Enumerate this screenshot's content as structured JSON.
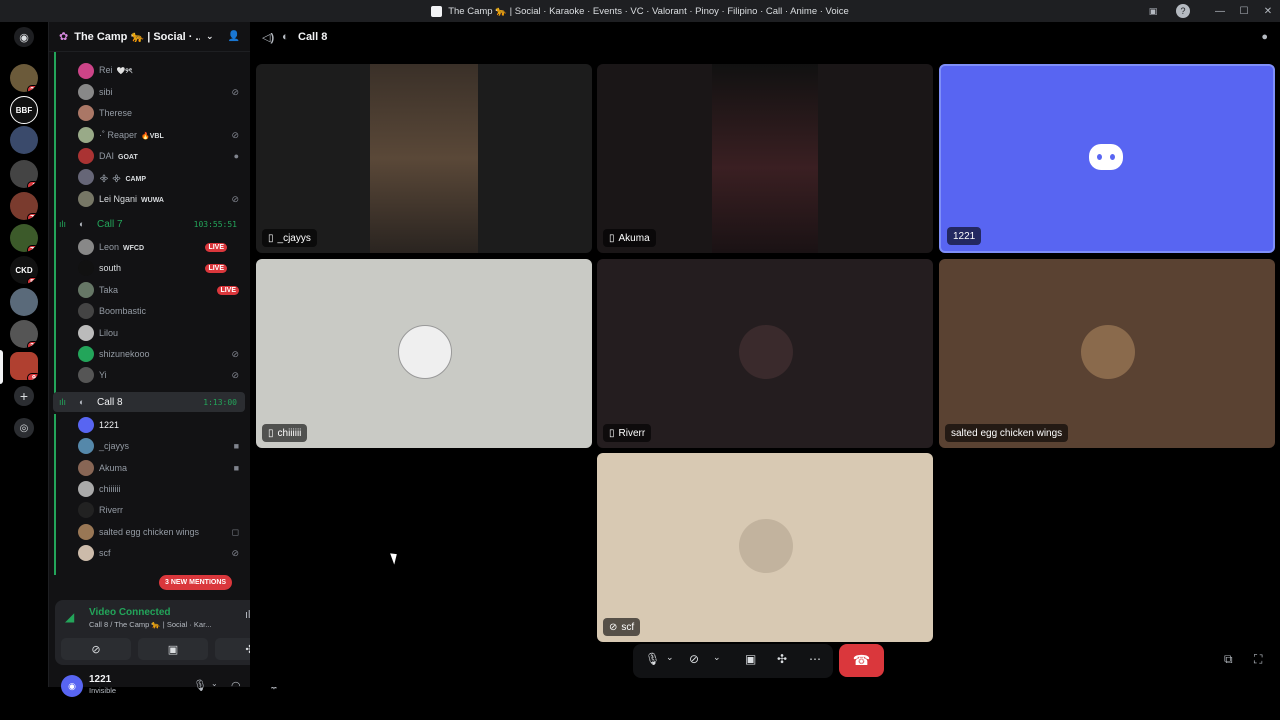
{
  "window": {
    "title": "The Camp 🐆 | Social · Karaoke · Events · VC · Valorant · Pinoy · Filipino · Call · Anime · Voice"
  },
  "server": {
    "name": "The Camp 🐆 | Social · ..."
  },
  "rail": {
    "badges": [
      "26",
      "1",
      "71",
      "79",
      "54",
      "30",
      "9"
    ]
  },
  "channels": {
    "top_members": [
      {
        "name": "Rei",
        "tag": "🤍୨ৎ"
      },
      {
        "name": "sibi",
        "tag": ""
      },
      {
        "name": "Therese",
        "tag": ""
      },
      {
        "name": "·˚ Reaper",
        "tag": "🔥VBL"
      },
      {
        "name": "DAI",
        "tag": "GOAT"
      },
      {
        "name": "᯽ ᯽",
        "tag": "CAMP"
      },
      {
        "name": "Lei Ngani",
        "tag": "WUWA"
      }
    ],
    "call7": {
      "name": "Call 7",
      "time": "103:55:51"
    },
    "call7_members": [
      {
        "name": "Leon",
        "tag": "WFCD",
        "live": "LIVE"
      },
      {
        "name": "south",
        "tag": "",
        "live": "LIVE"
      },
      {
        "name": "Taka",
        "tag": "",
        "live": "LIVE"
      },
      {
        "name": "Boombastic",
        "tag": "",
        "live": ""
      },
      {
        "name": "Lilou",
        "tag": "",
        "live": ""
      },
      {
        "name": "shizunekooo",
        "tag": "",
        "live": ""
      },
      {
        "name": "Yi",
        "tag": "",
        "live": ""
      }
    ],
    "call8": {
      "name": "Call 8",
      "time": "1:13:00"
    },
    "call8_members": [
      {
        "name": "1221"
      },
      {
        "name": "_cjayys"
      },
      {
        "name": "Akuma"
      },
      {
        "name": "chiiiiii"
      },
      {
        "name": "Riverr"
      },
      {
        "name": "salted egg chicken wings"
      },
      {
        "name": "scf"
      }
    ],
    "mentions": "3 NEW MENTIONS"
  },
  "voice": {
    "status": "Video Connected",
    "sub": "Call 8 / The Camp 🐆 | Social · Kar..."
  },
  "user": {
    "name": "1221",
    "status": "Invisible"
  },
  "main": {
    "channel": "Call 8"
  },
  "tiles": [
    "_cjayys",
    "Akuma",
    "1221",
    "chiiiiii",
    "Riverr",
    "salted egg chicken wings",
    "scf"
  ],
  "colors": {
    "accent": "#5865f2",
    "live": "#da373c",
    "connected": "#23a55a"
  }
}
